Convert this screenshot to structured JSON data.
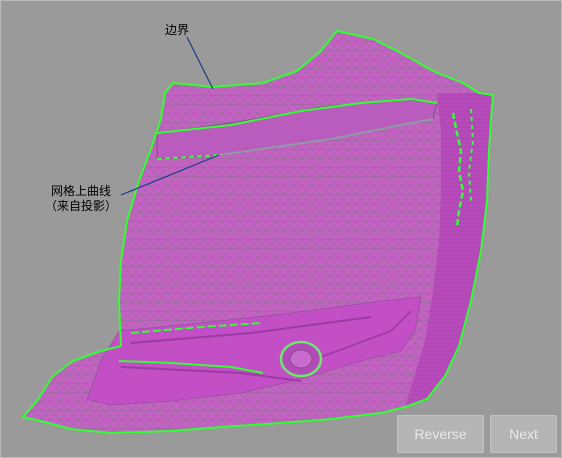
{
  "annotations": {
    "boundary_label": "边界",
    "curve_label_line1": "网格上曲线",
    "curve_label_line2": "（来自投影）"
  },
  "buttons": {
    "reverse": "Reverse",
    "next": "Next"
  },
  "colors": {
    "background": "#9a9a9a",
    "mesh": "#c85ac8",
    "mesh_dark": "#a535a8",
    "boundary": "#33ff33",
    "leader_line": "#1a3e8c",
    "button_bg": "#b4b4b4",
    "button_text": "#e9e9e9"
  }
}
